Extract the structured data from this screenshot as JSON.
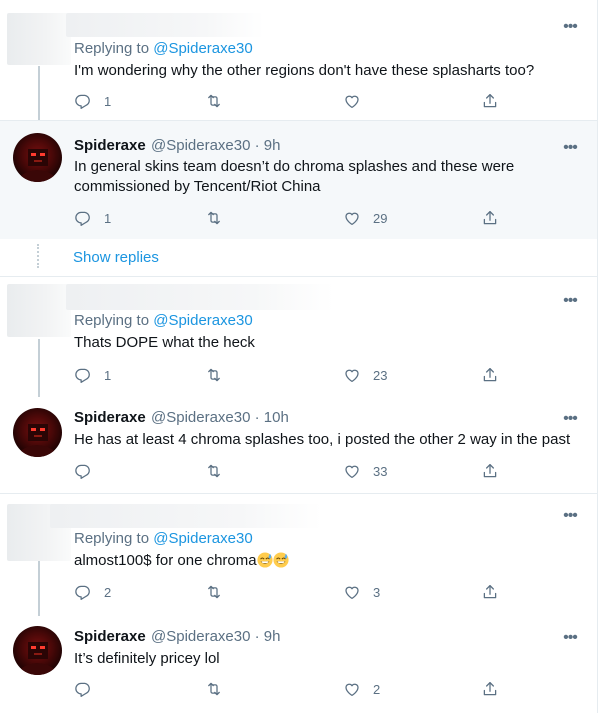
{
  "common": {
    "replying_prefix": "Replying to",
    "more_glyph": "•••",
    "show_replies": "Show replies"
  },
  "tweets": [
    {
      "replying_to": "@Spideraxe30",
      "text": "I'm wondering why the other regions don't have these splasharts too?",
      "reply_count": "1",
      "retweet_count": "",
      "like_count": ""
    },
    {
      "author_name": "Spideraxe",
      "author_handle": "@Spideraxe30 · 9h",
      "text": "In general skins team doesn’t do chroma splashes and these were commissioned by Tencent/Riot China",
      "reply_count": "1",
      "retweet_count": "",
      "like_count": "29"
    },
    {
      "replying_to": "@Spideraxe30",
      "text": "Thats DOPE what the heck",
      "reply_count": "1",
      "retweet_count": "",
      "like_count": "23"
    },
    {
      "author_name": "Spideraxe",
      "author_handle": "@Spideraxe30 · 10h",
      "text": "He has at least 4 chroma splashes too, i posted the other 2 way in the past",
      "reply_count": "",
      "retweet_count": "",
      "like_count": "33"
    },
    {
      "replying_to": "@Spideraxe30",
      "text": "almost100$ for one chroma",
      "emoji_names": [
        "grinning-face-with-sweat",
        "grinning-face-with-sweat"
      ],
      "reply_count": "2",
      "retweet_count": "",
      "like_count": "3"
    },
    {
      "author_name": "Spideraxe",
      "author_handle": "@Spideraxe30 · 9h",
      "text": "It’s definitely pricey lol",
      "reply_count": "",
      "retweet_count": "",
      "like_count": "2"
    }
  ],
  "icons": {
    "reply": "reply-icon",
    "retweet": "retweet-icon",
    "like": "heart-icon",
    "share": "share-icon",
    "more": "more-options-icon"
  },
  "colors": {
    "link": "#1b95e0",
    "secondary": "#5b7083",
    "highlight_bg": "#f5f8fa",
    "divider": "#e6ecf0"
  }
}
